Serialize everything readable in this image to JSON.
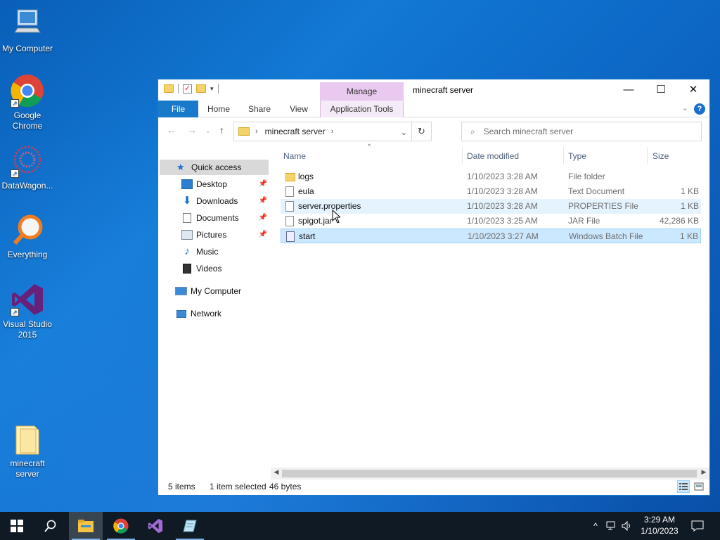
{
  "desktop": {
    "icons": [
      {
        "label": "My Computer"
      },
      {
        "label": "Google Chrome"
      },
      {
        "label": "DataWagon..."
      },
      {
        "label": "Everything"
      },
      {
        "label": "Visual Studio 2015"
      },
      {
        "label": "minecraft server"
      }
    ]
  },
  "window": {
    "title": "minecraft server",
    "manage_tab": "Manage",
    "ribbon_tabs": [
      "File",
      "Home",
      "Share",
      "View",
      "Application Tools"
    ],
    "address": {
      "crumb": "minecraft server"
    },
    "search": {
      "placeholder": "Search minecraft server"
    },
    "nav": {
      "quick_access": "Quick access",
      "items": [
        {
          "label": "Desktop",
          "pinned": true
        },
        {
          "label": "Downloads",
          "pinned": true
        },
        {
          "label": "Documents",
          "pinned": true
        },
        {
          "label": "Pictures",
          "pinned": true
        },
        {
          "label": "Music",
          "pinned": false
        },
        {
          "label": "Videos",
          "pinned": false
        }
      ],
      "my_computer": "My Computer",
      "network": "Network"
    },
    "columns": {
      "name": "Name",
      "date": "Date modified",
      "type": "Type",
      "size": "Size"
    },
    "files": [
      {
        "name": "logs",
        "date": "1/10/2023 3:28 AM",
        "type": "File folder",
        "size": "",
        "icon": "folder-icon"
      },
      {
        "name": "eula",
        "date": "1/10/2023 3:28 AM",
        "type": "Text Document",
        "size": "1 KB",
        "icon": "text-file-icon"
      },
      {
        "name": "server.properties",
        "date": "1/10/2023 3:28 AM",
        "type": "PROPERTIES File",
        "size": "1 KB",
        "icon": "file-icon"
      },
      {
        "name": "spigot.jar",
        "date": "1/10/2023 3:25 AM",
        "type": "JAR File",
        "size": "42,286 KB",
        "icon": "file-icon"
      },
      {
        "name": "start",
        "date": "1/10/2023 3:27 AM",
        "type": "Windows Batch File",
        "size": "1 KB",
        "icon": "batch-file-icon"
      }
    ],
    "status": {
      "items": "5 items",
      "selected": "1 item selected",
      "bytes": "46 bytes"
    }
  },
  "taskbar": {
    "clock_time": "3:29 AM",
    "clock_date": "1/10/2023"
  },
  "colors": {
    "accent": "#1979ca",
    "selection": "#cce8ff",
    "manage": "#e9c9ef",
    "taskbar": "#101a24"
  }
}
